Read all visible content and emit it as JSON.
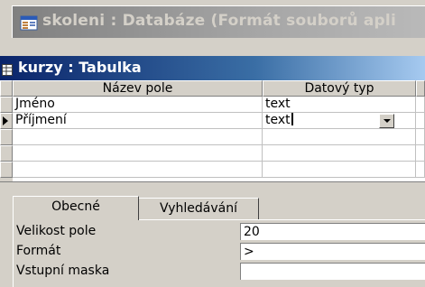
{
  "db_window": {
    "title": "skoleni : Databáze (Formát souborů apli",
    "icon": "database-window-icon"
  },
  "table_window": {
    "title": "kurzy : Tabulka",
    "icon": "table-design-icon"
  },
  "grid": {
    "headers": {
      "field_name": "Název pole",
      "data_type": "Datový typ"
    },
    "rows": [
      {
        "name": "Jméno",
        "type": "text"
      },
      {
        "name": "Příjmení",
        "type": "text",
        "current": true
      }
    ]
  },
  "properties": {
    "tabs": [
      "Obecné",
      "Vyhledávání"
    ],
    "active_tab": "Obecné",
    "fields": [
      {
        "label": "Velikost pole",
        "value": "20"
      },
      {
        "label": "Formát",
        "value": ">"
      },
      {
        "label": "Vstupní maska",
        "value": ""
      }
    ]
  }
}
